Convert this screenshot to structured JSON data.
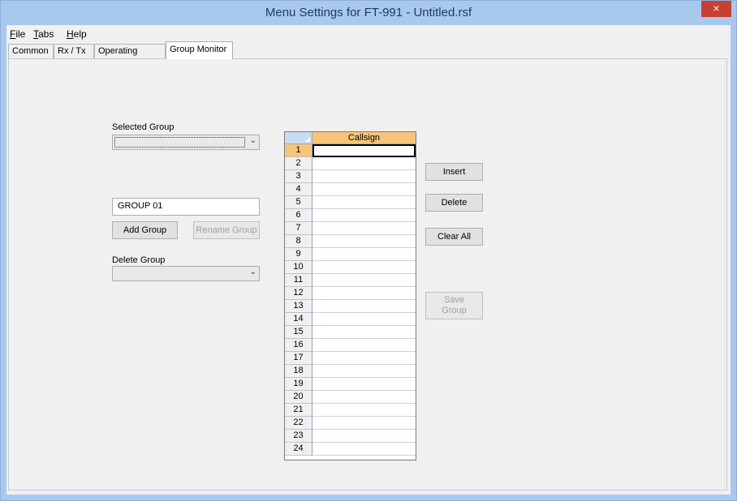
{
  "window": {
    "title": "Menu Settings for FT-991 - Untitled.rsf",
    "close_glyph": "×"
  },
  "menubar": {
    "items": [
      {
        "mnemonic": "F",
        "rest": "ile"
      },
      {
        "mnemonic": "T",
        "rest": "abs"
      },
      {
        "mnemonic": "H",
        "rest": "elp"
      }
    ]
  },
  "tabs": [
    {
      "label": "Common"
    },
    {
      "label": "Rx / Tx"
    },
    {
      "label": "Operating Mode"
    },
    {
      "label": "Group Monitor",
      "active": true
    }
  ],
  "group_panel": {
    "selected_group_label": "Selected Group",
    "selected_group_value": "",
    "group_name_value": "GROUP 01",
    "add_group_label": "Add Group",
    "rename_group_label": "Rename Group",
    "delete_group_label": "Delete Group",
    "delete_group_value": ""
  },
  "grid": {
    "column_header": "Callsign",
    "row_numbers": [
      "1",
      "2",
      "3",
      "4",
      "5",
      "6",
      "7",
      "8",
      "9",
      "10",
      "11",
      "12",
      "13",
      "14",
      "15",
      "16",
      "17",
      "18",
      "19",
      "20",
      "21",
      "22",
      "23",
      "24"
    ],
    "selected_row": 1
  },
  "actions": {
    "insert_label": "Insert",
    "delete_label": "Delete",
    "clear_all_label": "Clear All",
    "save_group_line1": "Save",
    "save_group_line2": "Group"
  }
}
